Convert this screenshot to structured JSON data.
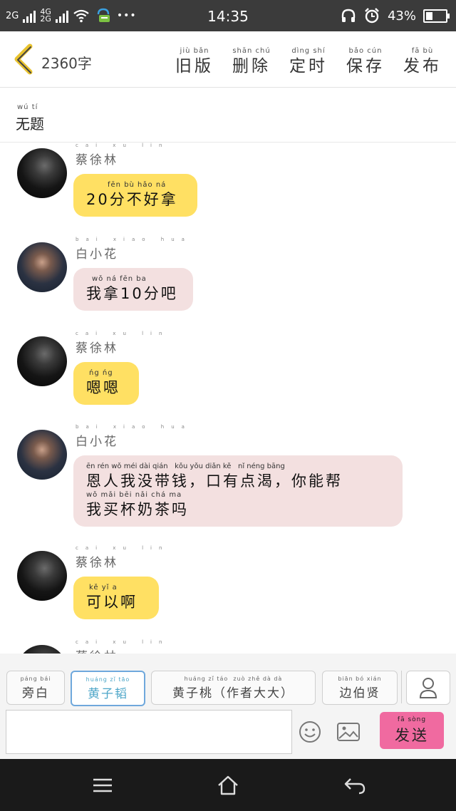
{
  "status_bar": {
    "sim1": "2G",
    "sim2_top": "4G",
    "sim2_bottom": "2G",
    "dots": "•••",
    "time": "14:35",
    "battery": "43%",
    "battery_fraction": 0.43
  },
  "toolbar": {
    "word_count": "2360字",
    "actions": [
      {
        "pinyin": "jiù bǎn",
        "label": "旧版"
      },
      {
        "pinyin": "shān chú",
        "label": "删除"
      },
      {
        "pinyin": "dìng shí",
        "label": "定时"
      },
      {
        "pinyin": "bǎo cún",
        "label": "保存"
      },
      {
        "pinyin": "fā bù",
        "label": "发布"
      }
    ]
  },
  "document": {
    "title_pinyin": "wú tí",
    "title": "无题"
  },
  "messages": [
    {
      "name_pinyin": "cai xu lin",
      "name": "蔡徐林",
      "bubble_pinyin": "fēn bù hǎo ná",
      "text": "20分不好拿",
      "color": "#ffe063"
    },
    {
      "name_pinyin": "bai xiao hua",
      "name": "白小花",
      "bubble_pinyin": "wǒ ná fēn ba",
      "text": "我拿10分吧",
      "color": "#f3e0e0"
    },
    {
      "name_pinyin": "cai xu lin",
      "name": "蔡徐林",
      "bubble_pinyin": "ńg ńg",
      "text": "嗯嗯",
      "color": "#ffe063"
    },
    {
      "name_pinyin": "bai xiao hua",
      "name": "白小花",
      "bubble_pinyin": "ēn rén wǒ méi dài qián   kǒu yǒu diǎn kě   nǐ néng bāng",
      "text": "恩人我没带钱，口有点渴，你能帮",
      "bubble_pinyin_2": "wǒ mǎi bēi nǎi chá ma",
      "text_2": "我买杯奶茶吗",
      "color": "#f3e0e0"
    },
    {
      "name_pinyin": "cai xu lin",
      "name": "蔡徐林",
      "bubble_pinyin": "kě yǐ a",
      "text": "可以啊",
      "color": "#ffe063"
    },
    {
      "name_pinyin": "cai xu lin",
      "name": "蔡徐林"
    }
  ],
  "character_bar": {
    "chips": [
      {
        "pinyin": "páng bái",
        "label": "旁白"
      },
      {
        "pinyin": "huáng zǐ tāo",
        "label": "黄子韬"
      },
      {
        "pinyin": "huáng zǐ táo  zuò zhě dà dà",
        "label": "黄子桃（作者大大）"
      },
      {
        "pinyin": "biān bó xián",
        "label": "边伯贤"
      }
    ],
    "send_pinyin": "fā sòng",
    "send_label": "发送"
  },
  "colors": {
    "accent_yellow": "#ffe063",
    "accent_pink": "#f3e0e0",
    "send_button": "#f06aa0",
    "active_chip": "#4da6c8"
  },
  "icons": [
    "back-chevron-icon",
    "person-icon",
    "emoji-icon",
    "image-icon",
    "menu-icon",
    "home-icon",
    "back-arrow-icon"
  ]
}
